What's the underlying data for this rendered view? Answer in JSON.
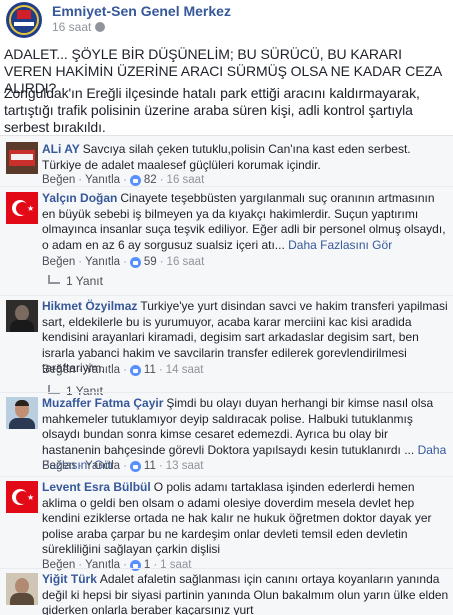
{
  "page": {
    "name": "Emniyet-Sen Genel Merkez",
    "time": "16 saat"
  },
  "post": {
    "headline": "ADALET... ŞÖYLE BİR DÜŞÜNELİM; BU SÜRÜCÜ, BU KARARI VEREN HAKİMİN ÜZERİNE ARACI SÜRMÜŞ OLSA NE KADAR CEZA ALIRDI?",
    "body": "Zonguldak'ın Ereğli ilçesinde hatalı park ettiği aracını kaldırmayarak, tartıştığı trafik polisinin üzerine araba süren kişi, adli kontrol şartıyla serbest bırakıldı."
  },
  "actions": {
    "like": "Beğen",
    "reply": "Yanıtla",
    "dot": "·"
  },
  "comments": [
    {
      "name": "ALi AY",
      "text": "Savcıya silah çeken tutuklu,polisin Can'ına kast eden serbest. Türkiye de adalet maalesef güçlüleri korumak içindir.",
      "likes": "82",
      "time": "16 saat"
    },
    {
      "name": "Yalçın Doğan",
      "text": "Cinayete teşebbüsten yargılanmalı suç oranının artmasının en büyük sebebi iş bilmeyen ya da kıyakçı hakimlerdir. Suçun yaptırımı olmayınca insanlar suça teşvik ediliyor. Eğer adli bir personel olmuş olsaydı, o adam en az 6 ay sorgusuz sualsiz içeri atı...",
      "see_more": "Daha Fazlasını Gör",
      "likes": "59",
      "time": "16 saat",
      "replies": "1 Yanıt"
    },
    {
      "name": "Hikmet Özyilmaz",
      "text": "Turkiye'ye yurt disindan savci ve hakim transferi yapilmasi sart, eldekilerle bu is yurumuyor, acaba karar merciini kac kisi aradida kendisini arayanlari kiramadi, degisim sart arkadaslar degisim sart, ben israrla yabanci hakim ve savcilarin transfer edilerek gorevlendirilmesi taraftariyim.",
      "likes": "11",
      "time": "14 saat",
      "replies": "1 Yanıt"
    },
    {
      "name": "Muzaffer Fatma Çayir",
      "text": "Şimdi bu olayı duyan herhangi bir kimse nasıl olsa mahkemeler tutuklamıyor deyip saldıracak polise. Halbuki tutuklanmış olsaydı bundan sonra kimse cesaret edemezdi. Ayrıca bu olay bir hastanenin bahçesinde görevli Doktora yapılsaydı kesin tutuklanırdı ...",
      "see_more": "Daha Fazlasını Gör",
      "likes": "11",
      "time": "13 saat"
    },
    {
      "name": "Levent Esra Bülbül",
      "text": "O polis adamı tartaklasa işinden ederlerdi hemen aklima o geldi ben olsam o adami olesiye doverdim mesela devlet hep kendini eziklerse ortada ne hak kalır ne hukuk öğretmen doktor dayak yer polise araba çarpar bu ne kardeşim onlar devleti temsil eden devletin sürekliliğini sağlayan çarkin dişlisi",
      "likes": "1",
      "time": "1 saat"
    },
    {
      "name": "Yiğit Türk",
      "text": "Adalet afaletin sağlanması için canını ortaya koyanların yanında değil ki hepsi bir siyasi partinin yanında Olun bakalmım olun yarın ülke elden giderken onlarla beraber kaçarsınız yurt"
    }
  ],
  "colors": {
    "link_blue": "#365899",
    "like_blue": "#5890ff",
    "comment_bg": "#f6f7f9",
    "meta_gray": "#90949c"
  }
}
